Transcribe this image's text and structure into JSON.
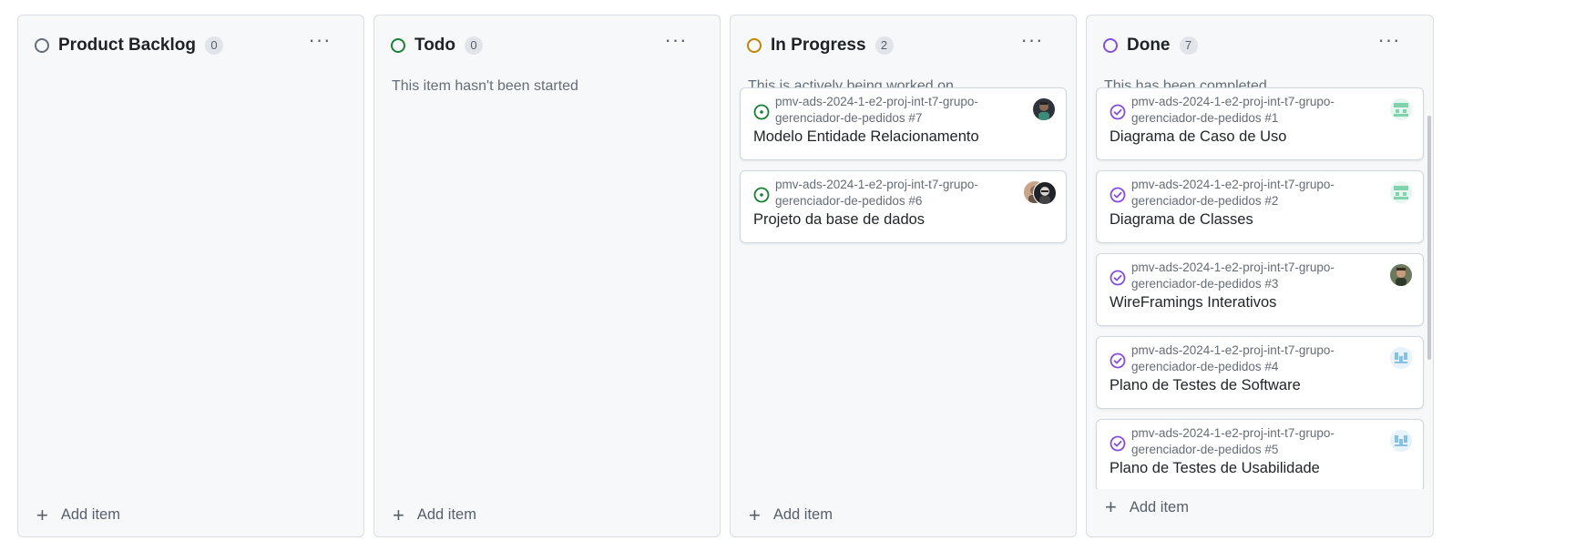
{
  "colors": {
    "backlog": "#656d76",
    "todo": "#1a7f37",
    "in_progress": "#bf8700",
    "done": "#8250df"
  },
  "columns": [
    {
      "title": "Product Backlog",
      "count": "0",
      "description": "",
      "add_label": "Add item",
      "status_icon": "circle-icon"
    },
    {
      "title": "Todo",
      "count": "0",
      "description": "This item hasn't been started",
      "add_label": "Add item",
      "status_icon": "circle-icon"
    },
    {
      "title": "In Progress",
      "count": "2",
      "description": "This is actively being worked on",
      "add_label": "Add item",
      "status_icon": "circle-icon",
      "cards": [
        {
          "repo": "pmv-ads-2024-1-e2-proj-int-t7-grupo-gerenciador-de-pedidos #7",
          "title": "Modelo Entidade Relacionamento",
          "icon": "open-issue-icon",
          "avatar": "user-avatar"
        },
        {
          "repo": "pmv-ads-2024-1-e2-proj-int-t7-grupo-gerenciador-de-pedidos #6",
          "title": "Projeto da base de dados",
          "icon": "open-issue-icon",
          "avatar": "stacked-user-avatars"
        }
      ]
    },
    {
      "title": "Done",
      "count": "7",
      "description": "This has been completed",
      "add_label": "Add item",
      "status_icon": "circle-icon",
      "cards": [
        {
          "repo": "pmv-ads-2024-1-e2-proj-int-t7-grupo-gerenciador-de-pedidos #1",
          "title": "Diagrama de Caso de Uso",
          "icon": "closed-issue-icon",
          "avatar": "identicon-avatar"
        },
        {
          "repo": "pmv-ads-2024-1-e2-proj-int-t7-grupo-gerenciador-de-pedidos #2",
          "title": "Diagrama de Classes",
          "icon": "closed-issue-icon",
          "avatar": "identicon-avatar"
        },
        {
          "repo": "pmv-ads-2024-1-e2-proj-int-t7-grupo-gerenciador-de-pedidos #3",
          "title": "WireFramings Interativos",
          "icon": "closed-issue-icon",
          "avatar": "user-avatar"
        },
        {
          "repo": "pmv-ads-2024-1-e2-proj-int-t7-grupo-gerenciador-de-pedidos #4",
          "title": "Plano de Testes de Software",
          "icon": "closed-issue-icon",
          "avatar": "identicon-avatar"
        },
        {
          "repo": "pmv-ads-2024-1-e2-proj-int-t7-grupo-gerenciador-de-pedidos #5",
          "title": "Plano de Testes de Usabilidade",
          "icon": "closed-issue-icon",
          "avatar": "identicon-avatar"
        }
      ]
    }
  ]
}
